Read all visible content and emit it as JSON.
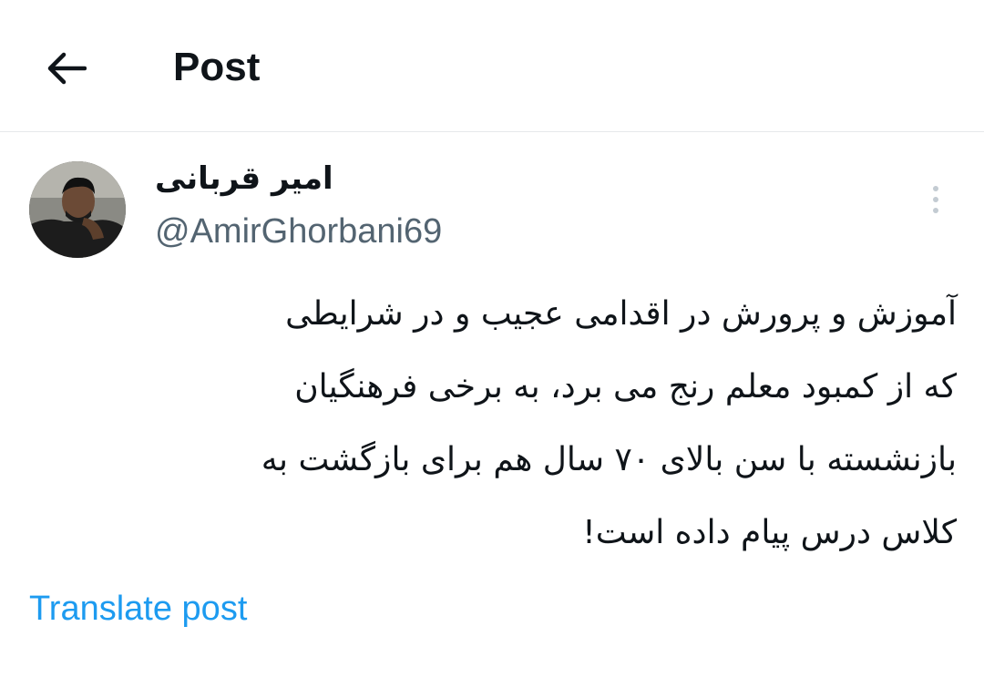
{
  "header": {
    "back_icon": "arrow-left-icon",
    "title": "Post"
  },
  "tweet": {
    "author": {
      "name": "امیر قربانی",
      "handle": "@AmirGhorbani69",
      "avatar_icon": "user-avatar"
    },
    "more_icon": "more-vertical-icon",
    "text_lines": [
      "آموزش و پرورش در اقدامی عجیب و در شرایطی",
      "که از کمبود معلم رنج می برد، به برخی فرهنگیان",
      "بازنشسته با سن بالای ۷۰ سال هم برای بازگشت به",
      "کلاس درس پیام داده است!"
    ],
    "translate_label": "Translate post"
  },
  "colors": {
    "text": "#0f1419",
    "secondary": "#536471",
    "link": "#1d9bf0",
    "divider": "#e6e9eb"
  }
}
